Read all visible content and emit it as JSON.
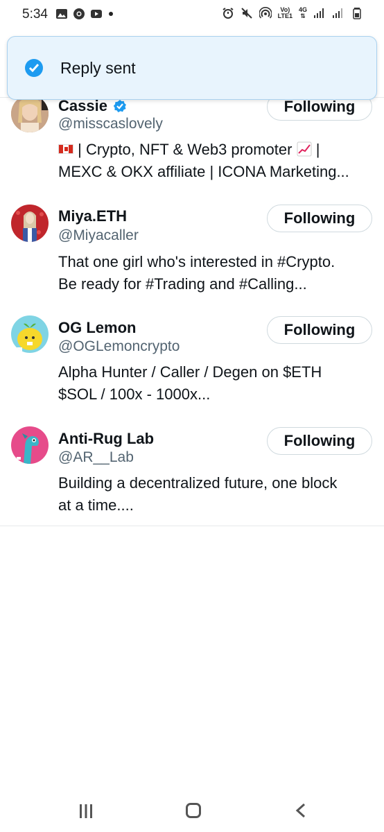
{
  "status_bar": {
    "time": "5:34",
    "left_icons": [
      "gallery-icon",
      "chrome-icon",
      "youtube-icon",
      "notification-dot-icon"
    ],
    "right_icons": [
      "alarm-icon",
      "mute-icon",
      "hotspot-icon",
      "volte-icon",
      "4g-icon",
      "signal-icon",
      "signal-icon-2",
      "battery-icon"
    ],
    "volte_label_top": "Vo)",
    "volte_label_bottom": "LTE1",
    "net_label": "4G"
  },
  "toast": {
    "message": "Reply sent",
    "icon": "check-circle-icon",
    "accent": "#1d9bf0"
  },
  "users": [
    {
      "name": "Cassie",
      "verified": true,
      "handle": "@misscaslovely",
      "bio_line1_pre": "| Crypto, NFT & Web3 promoter",
      "bio_line1_post": "|",
      "bio_line2": "MEXC & OKX affiliate | ICONA Marketing...",
      "button_label": "Following"
    },
    {
      "name": "Miya.ETH",
      "verified": false,
      "handle": "@Miyacaller",
      "bio_line1": "That one girl who's interested in #Crypto.",
      "bio_line2": "Be ready for #Trading and #Calling...",
      "button_label": "Following"
    },
    {
      "name": "OG Lemon",
      "verified": false,
      "handle": "@OGLemoncrypto",
      "bio_line1": "Alpha Hunter / Caller / Degen on $ETH",
      "bio_line2": "$SOL / 100x - 1000x...",
      "button_label": "Following"
    },
    {
      "name": "Anti-Rug Lab",
      "verified": false,
      "handle": "@AR__Lab",
      "bio_line1": "Building a decentralized future, one block",
      "bio_line2": "at a time....",
      "button_label": "Following"
    }
  ],
  "nav_bar": {
    "icons": [
      "recent-apps-icon",
      "home-icon",
      "back-icon"
    ]
  }
}
